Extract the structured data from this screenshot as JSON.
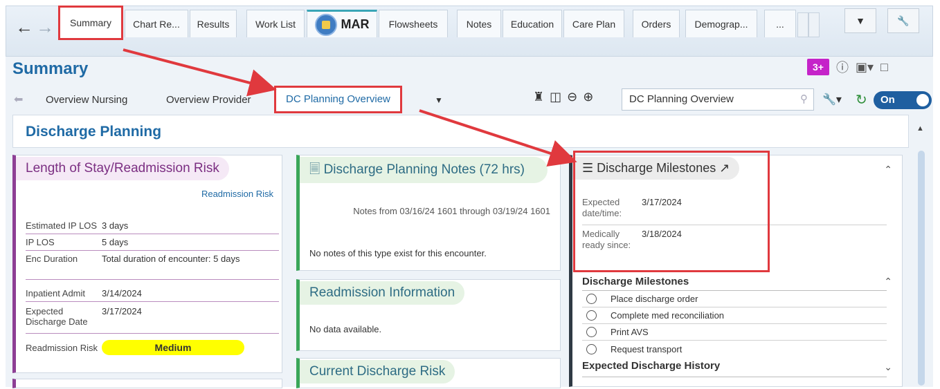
{
  "tabs": [
    {
      "label": "Summary",
      "active": true
    },
    {
      "label": "Chart Re..."
    },
    {
      "label": "Results"
    },
    {
      "label": "Work List"
    },
    {
      "label": "MAR"
    },
    {
      "label": "Flowsheets"
    },
    {
      "label": "Notes"
    },
    {
      "label": "Education"
    },
    {
      "label": "Care Plan"
    },
    {
      "label": "Orders"
    },
    {
      "label": "Demograp..."
    },
    {
      "label": "..."
    }
  ],
  "summary": {
    "title": "Summary",
    "badge": "3+"
  },
  "subtabs": [
    {
      "label": "Overview Nursing"
    },
    {
      "label": "Overview Provider"
    },
    {
      "label": "DC Planning Overview",
      "active": true
    }
  ],
  "search": {
    "value": "DC Planning Overview"
  },
  "toggle": {
    "label": "On"
  },
  "section": {
    "title": "Discharge Planning"
  },
  "los": {
    "title": "Length of Stay/Readmission Risk",
    "link": "Readmission Risk",
    "rows": [
      {
        "k": "Estimated IP LOS",
        "v": "3 days"
      },
      {
        "k": "IP LOS",
        "v": "5 days"
      },
      {
        "k": "Enc Duration",
        "v": "Total duration of encounter: 5 days"
      },
      {
        "k": "Inpatient Admit",
        "v": "3/14/2024"
      },
      {
        "k": "Expected Discharge Date",
        "v": "3/17/2024"
      },
      {
        "k": "Readmission Risk",
        "v": "Medium"
      }
    ]
  },
  "notes": {
    "title": "Discharge Planning Notes (72 hrs)",
    "subtitle": "Notes from 03/16/24 1601 through 03/19/24 1601",
    "empty": "No notes of this type exist for this encounter."
  },
  "readmission": {
    "title": "Readmission Information",
    "empty": "No data available."
  },
  "current_risk": {
    "title": "Current Discharge Risk"
  },
  "milestones": {
    "title": "Discharge Milestones",
    "expected_label": "Expected date/time:",
    "expected_value": "3/17/2024",
    "ready_label": "Medically ready since:",
    "ready_value": "3/18/2024",
    "list_title": "Discharge Milestones",
    "items": [
      "Place discharge order",
      "Complete med reconciliation",
      "Print AVS",
      "Request transport"
    ],
    "history_title": "Expected Discharge History"
  },
  "colors": {
    "highlight": "#e0393e",
    "accent": "#1f6aa5"
  }
}
